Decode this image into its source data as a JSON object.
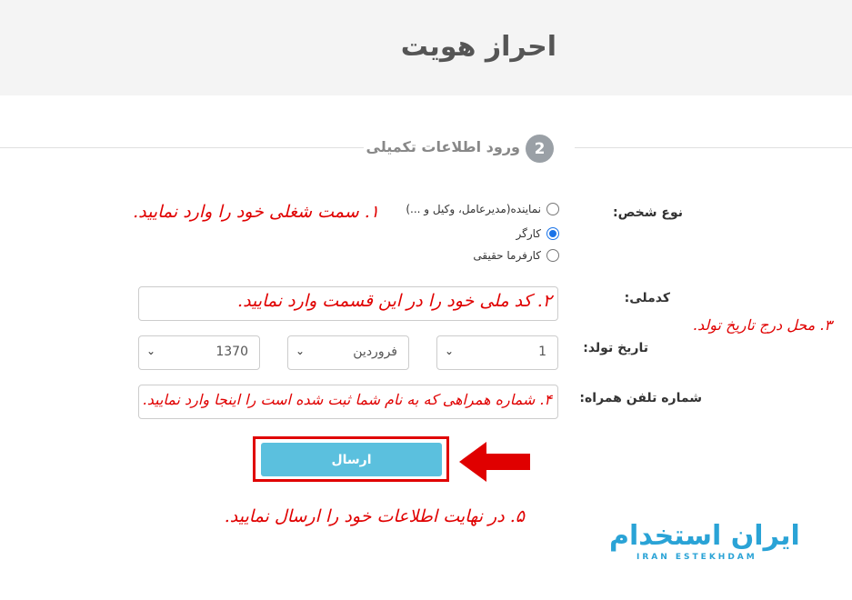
{
  "header": {
    "title": "احراز هویت"
  },
  "step": {
    "number": "2",
    "label": "ورود اطلاعات تکمیلی"
  },
  "form": {
    "person_type_label": "نوع شخص:",
    "person_type_options": [
      {
        "label": "نماینده(مدیرعامل، وکیل و ...)",
        "checked": false
      },
      {
        "label": "کارگر",
        "checked": true
      },
      {
        "label": "کارفرما حقیقی",
        "checked": false
      }
    ],
    "national_code_label": "کدملی:",
    "national_code_value": "",
    "birth_date_label": "تاریخ تولد:",
    "birth_day": "1",
    "birth_month": "فروردین",
    "birth_year": "1370",
    "phone_label": "شماره تلفن همراه:",
    "phone_value": "",
    "submit_label": "ارسال"
  },
  "annotations": {
    "a1": "۱. سمت شغلی خود را وارد نمایید.",
    "a2": "۲. کد ملی خود را در این قسمت وارد نمایید.",
    "a3": "۳. محل درج تاریخ تولد.",
    "a4": "۴. شماره همراهی که به نام شما ثبت شده است را اینجا وارد نمایید.",
    "a5": "۵. در نهایت اطلاعات خود را ارسال نمایید."
  },
  "logo": {
    "text": "ایران استخدام",
    "subtitle": "IRAN ESTEKHDAM"
  },
  "colors": {
    "accent": "#5bc0de",
    "annotation": "#e00000",
    "logo": "#2aa3d6"
  },
  "icons": {
    "select_chevron": "chevron-down-icon",
    "arrow": "arrow-left-icon"
  }
}
